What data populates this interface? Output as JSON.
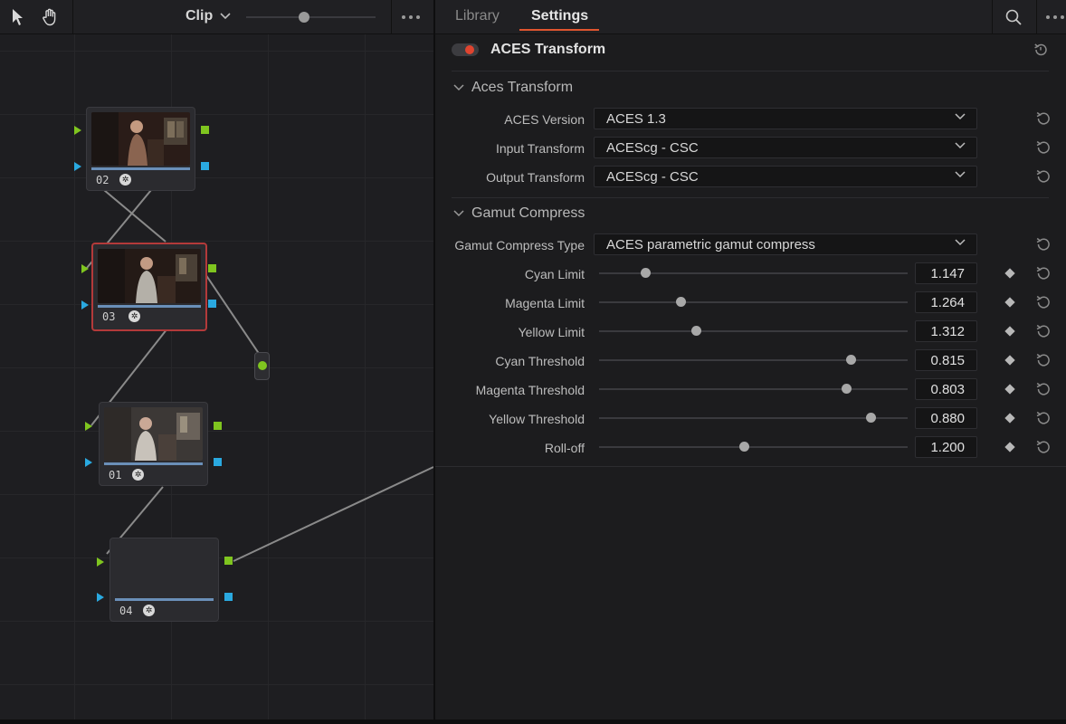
{
  "node_editor": {
    "clip_menu_label": "Clip",
    "tools": [
      "pointer-tool",
      "hand-tool"
    ],
    "nodes": [
      {
        "id": "02",
        "label": "02",
        "selected": false
      },
      {
        "id": "03",
        "label": "03",
        "selected": true
      },
      {
        "id": "01",
        "label": "01",
        "selected": false
      },
      {
        "id": "04",
        "label": "04",
        "selected": false
      }
    ],
    "port_colors": {
      "rgb_in": "#7fc51f",
      "key_out": "#2aa9e0",
      "selected_border": "#b33a3a"
    }
  },
  "settings": {
    "tabs": [
      {
        "label": "Library",
        "active": false
      },
      {
        "label": "Settings",
        "active": true
      }
    ],
    "effect": {
      "title": "ACES Transform",
      "enabled": true,
      "toggle_color": "#e0442f"
    },
    "aces_section": {
      "title": "Aces Transform",
      "rows": [
        {
          "label": "ACES Version",
          "value": "ACES 1.3"
        },
        {
          "label": "Input Transform",
          "value": "ACEScg - CSC"
        },
        {
          "label": "Output Transform",
          "value": "ACEScg - CSC"
        }
      ]
    },
    "gamut_section": {
      "title": "Gamut Compress",
      "type_row": {
        "label": "Gamut Compress Type",
        "value": "ACES parametric gamut compress"
      },
      "sliders": [
        {
          "label": "Cyan Limit",
          "value": "1.147",
          "position": 0.15
        },
        {
          "label": "Magenta Limit",
          "value": "1.264",
          "position": 0.265
        },
        {
          "label": "Yellow Limit",
          "value": "1.312",
          "position": 0.315
        },
        {
          "label": "Cyan Threshold",
          "value": "0.815",
          "position": 0.815
        },
        {
          "label": "Magenta Threshold",
          "value": "0.803",
          "position": 0.8
        },
        {
          "label": "Yellow Threshold",
          "value": "0.880",
          "position": 0.88
        },
        {
          "label": "Roll-off",
          "value": "1.200",
          "position": 0.47
        }
      ]
    }
  }
}
